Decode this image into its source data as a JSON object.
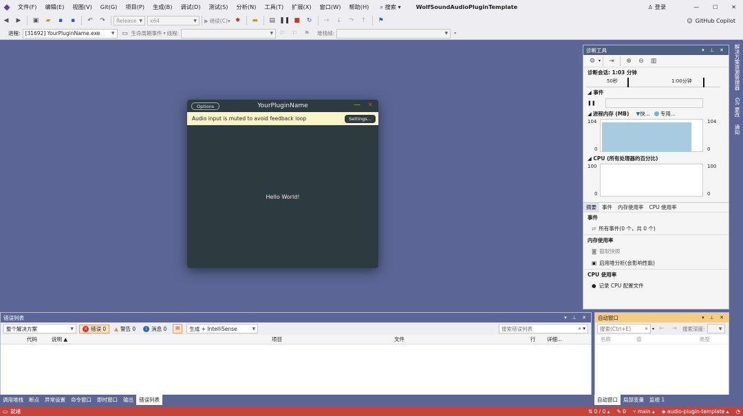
{
  "menu": {
    "items": [
      "文件(F)",
      "编辑(E)",
      "视图(V)",
      "Git(G)",
      "项目(P)",
      "生成(B)",
      "调试(D)",
      "测试(S)",
      "分析(N)",
      "工具(T)",
      "扩展(X)",
      "窗口(W)",
      "帮助(H)"
    ],
    "search_label": "搜索",
    "solution_name": "WolfSoundAudioPluginTemplate",
    "login": "登录",
    "copilot": "GitHub Copilot"
  },
  "toolbar": {
    "config": "Release",
    "platform": "x64",
    "continue": "继续(C)",
    "process_label": "进程:",
    "process_value": "[31692] YourPluginName.exe",
    "lifecycle_label": "生命周期事件",
    "thread_label": "线程:",
    "stackframe_label": "堆栈帧:"
  },
  "plugin": {
    "title": "YourPluginName",
    "options": "Options",
    "banner_text": "Audio input is muted to avoid feedback loop",
    "settings": "Settings...",
    "hello": "Hello World!"
  },
  "diag": {
    "title": "诊断工具",
    "session": "诊断会话: 1:03 分钟",
    "tick1": "50秒",
    "tick2": "1:00分钟",
    "events_label": "事件",
    "memory_label": "进程内存 (MB)",
    "legend_fast": "快...",
    "legend_priv": "专用...",
    "mem_max": "104",
    "mem_min": "0",
    "cpu_label": "CPU (所有处理器的百分比)",
    "cpu_max": "100",
    "cpu_min": "0",
    "tabs": [
      "摘要",
      "事件",
      "内存使用率",
      "CPU 使用率"
    ],
    "sec_events": "事件",
    "all_events": "所有事件(0 个，共 0 个)",
    "sec_memory": "内存使用率",
    "snapshot": "截取快照",
    "heap": "启用堆分析(会影响性能)",
    "sec_cpu": "CPU 使用率",
    "record_cpu": "记录 CPU 配置文件"
  },
  "right_tabs": [
    "解决方案资源管理器",
    "Git 更改",
    "通知"
  ],
  "errors": {
    "title": "错误列表",
    "scope": "整个解决方案",
    "err": "错误 0",
    "warn": "警告 0",
    "msg": "消息 0",
    "build": "生成 + IntelliSense",
    "search": "搜索错误列表",
    "cols": [
      "代码",
      "说明",
      "项目",
      "文件",
      "行",
      "详细..."
    ]
  },
  "bottom_tabs": [
    "调用堆栈",
    "断点",
    "异常设置",
    "命令窗口",
    "即时窗口",
    "输出",
    "错误列表"
  ],
  "immediate": {
    "title": "自动窗口",
    "search": "搜索(Ctrl+E)",
    "depth": "搜索深度:",
    "cols": [
      "名称",
      "值",
      "类型"
    ],
    "tabs": [
      "自动窗口",
      "局部变量",
      "监视 1"
    ]
  },
  "status": {
    "ready": "就绪",
    "lines": "0 / 0",
    "edits": "0",
    "branch": "main",
    "repo": "audio-plugin-template"
  }
}
